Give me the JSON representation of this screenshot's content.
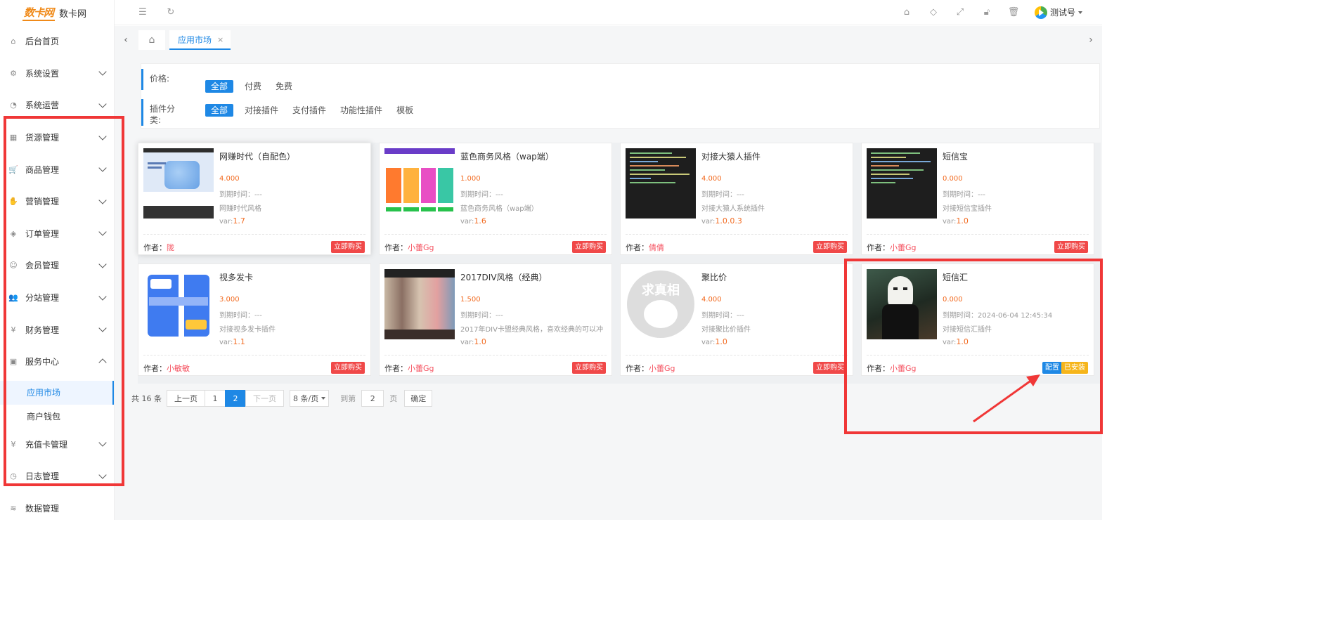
{
  "app": {
    "logo_mark": "数卡网",
    "name": "数卡网"
  },
  "sidebar": {
    "items": [
      {
        "label": "后台首页",
        "icon": "home-icon",
        "glyph": "⌂"
      },
      {
        "label": "系统设置",
        "icon": "gear-icon",
        "glyph": "⚙"
      },
      {
        "label": "系统运营",
        "icon": "operation-icon",
        "glyph": "◔"
      },
      {
        "label": "货源管理",
        "icon": "grid-icon",
        "glyph": "▦"
      },
      {
        "label": "商品管理",
        "icon": "cart-icon",
        "glyph": "🛒"
      },
      {
        "label": "营销管理",
        "icon": "hand-icon",
        "glyph": "✋"
      },
      {
        "label": "订单管理",
        "icon": "layers-icon",
        "glyph": "◈"
      },
      {
        "label": "会员管理",
        "icon": "member-icon",
        "glyph": "☺"
      },
      {
        "label": "分站管理",
        "icon": "users-icon",
        "glyph": "👥"
      },
      {
        "label": "财务管理",
        "icon": "yen-icon",
        "glyph": "¥"
      },
      {
        "label": "服务中心",
        "icon": "service-icon",
        "glyph": "▣"
      }
    ],
    "subitems": [
      {
        "label": "应用市场",
        "active": true
      },
      {
        "label": "商户钱包",
        "active": false
      }
    ],
    "after": [
      {
        "label": "充值卡管理",
        "icon": "card-yen-icon",
        "glyph": "¥"
      },
      {
        "label": "日志管理",
        "icon": "log-icon",
        "glyph": "◷"
      },
      {
        "label": "数据管理",
        "icon": "rss-icon",
        "glyph": "≋"
      }
    ]
  },
  "topbar": {
    "user": "测试号"
  },
  "tabs": {
    "active": "应用市场",
    "close": "×"
  },
  "filters": {
    "price_label": "价格:",
    "price_options": [
      "全部",
      "付费",
      "免费"
    ],
    "category_label": "插件分类:",
    "category_options": [
      "全部",
      "对接插件",
      "支付插件",
      "功能性插件",
      "模板"
    ]
  },
  "labels": {
    "expire_prefix": "到期时间：",
    "var_prefix": "var:",
    "author_prefix": "作者：",
    "buy": "立即购买",
    "config": "配置",
    "installed": "已安装"
  },
  "cards": [
    {
      "title": "网赚时代（自配色）",
      "price": "4.000",
      "expire": "---",
      "desc": "网赚时代风格",
      "version": "1.7",
      "author": "陇"
    },
    {
      "title": "蓝色商务风格（wap端）",
      "price": "1.000",
      "expire": "---",
      "desc": "蓝色商务风格（wap端）",
      "version": "1.6",
      "author": "小蕾Gg"
    },
    {
      "title": "对接大猿人插件",
      "price": "4.000",
      "expire": "---",
      "desc": "对接大猿人系统插件",
      "version": "1.0.0.3",
      "author": "倩倩"
    },
    {
      "title": "短信宝",
      "price": "0.000",
      "expire": "---",
      "desc": "对接短信宝插件",
      "version": "1.0",
      "author": "小蕾Gg"
    },
    {
      "title": "视多发卡",
      "price": "3.000",
      "expire": "---",
      "desc": "对接视多发卡插件",
      "version": "1.1",
      "author": "小敏敏"
    },
    {
      "title": "2017DIV风格（经典）",
      "price": "1.500",
      "expire": "---",
      "desc": "2017年DIV卡盟经典风格，喜欢经典的可以冲",
      "version": "1.0",
      "author": "小蕾Gg"
    },
    {
      "title": "聚比价",
      "price": "4.000",
      "expire": "---",
      "desc": "对接聚比价插件",
      "version": "1.0",
      "author": "小蕾Gg"
    },
    {
      "title": "短信汇",
      "price": "0.000",
      "expire": "2024-06-04 12:45:34",
      "desc": "对接短信汇插件",
      "version": "1.0",
      "author": "小蕾Gg"
    }
  ],
  "thumb_text": {
    "jubijia": "求真相"
  },
  "pagination": {
    "total": "共 16 条",
    "prev": "上一页",
    "pages": [
      "1",
      "2"
    ],
    "current": "2",
    "next": "下一页",
    "page_size": "8 条/页",
    "goto": "到第",
    "goto_value": "2",
    "page_unit": "页",
    "confirm": "确定"
  },
  "colors": {
    "accent": "#1e88e5",
    "price": "#f26b21",
    "buy": "#f04848",
    "installed": "#f6b51a",
    "annotation": "#f03737"
  }
}
